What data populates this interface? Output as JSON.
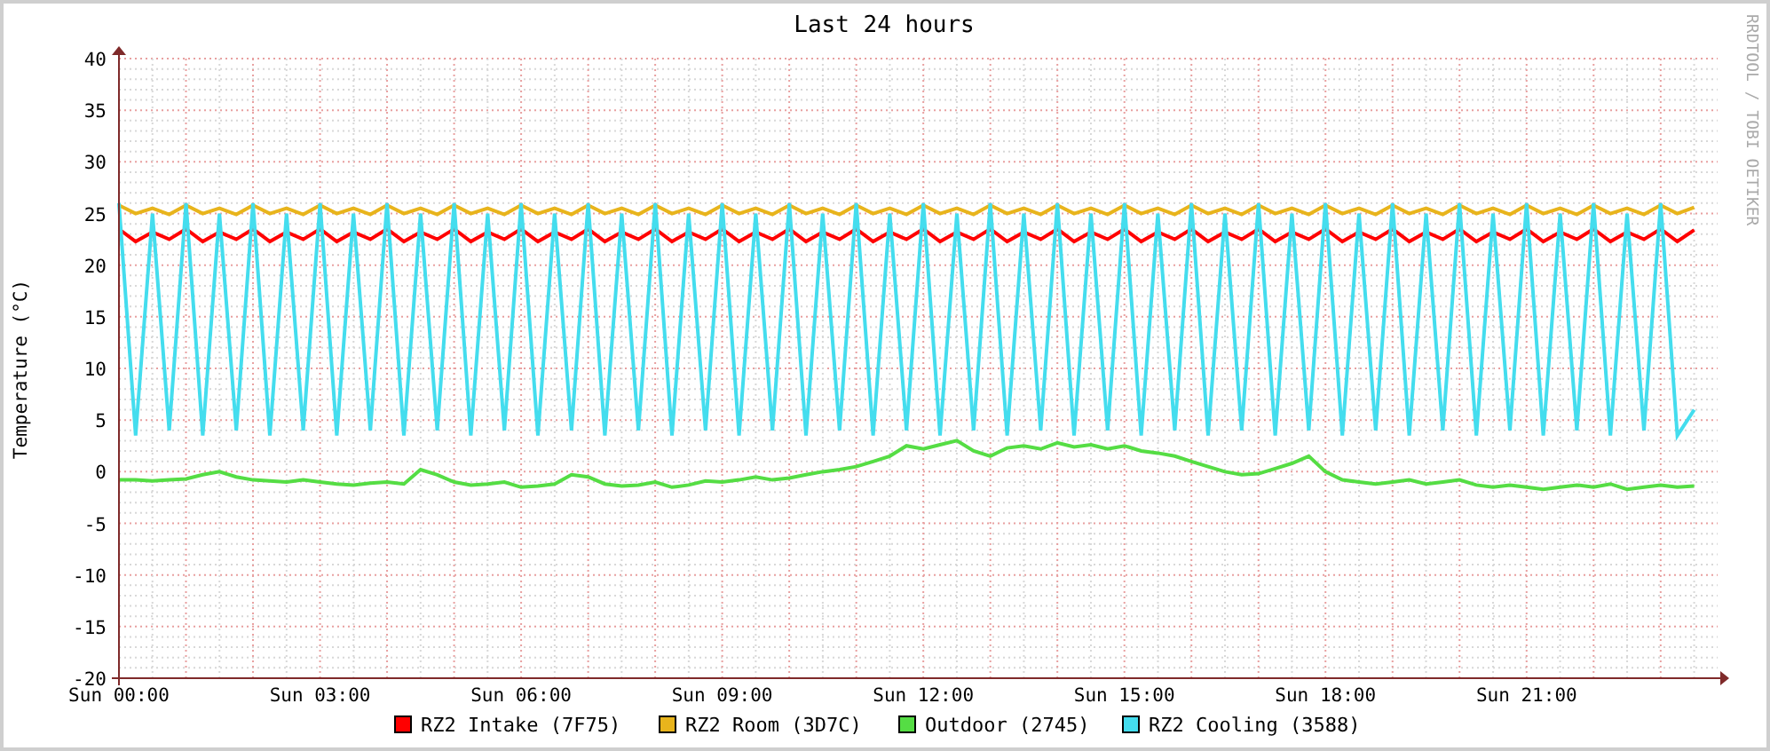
{
  "graph": {
    "side_text": "RRDTOOL / TOBI OETIKER",
    "chart_data": {
      "type": "line",
      "title": "Last 24 hours",
      "ylabel": "Temperature (°C)",
      "categories": [
        "Sun 00:00",
        null,
        null,
        null,
        null,
        null,
        null,
        null,
        null,
        null,
        null,
        null,
        "Sun 03:00",
        null,
        null,
        null,
        null,
        null,
        null,
        null,
        null,
        null,
        null,
        null,
        "Sun 06:00",
        null,
        null,
        null,
        null,
        null,
        null,
        null,
        null,
        null,
        null,
        null,
        "Sun 09:00",
        null,
        null,
        null,
        null,
        null,
        null,
        null,
        null,
        null,
        null,
        null,
        "Sun 12:00",
        null,
        null,
        null,
        null,
        null,
        null,
        null,
        null,
        null,
        null,
        null,
        "Sun 15:00",
        null,
        null,
        null,
        null,
        null,
        null,
        null,
        null,
        null,
        null,
        null,
        "Sun 18:00",
        null,
        null,
        null,
        null,
        null,
        null,
        null,
        null,
        null,
        null,
        null,
        "Sun 21:00",
        null,
        null,
        null,
        null,
        null,
        null,
        null,
        null,
        null,
        null
      ],
      "ylim": [
        -20,
        40
      ],
      "grid": true,
      "legend": "bottom",
      "yticks": [
        -20,
        -15,
        -10,
        -5,
        0,
        5,
        10,
        15,
        20,
        25,
        30,
        35,
        40
      ],
      "series": [
        {
          "name": "RZ2 Intake (7F75)",
          "color": "#ff0000",
          "values": [
            23.5,
            22.3,
            23.2,
            22.5,
            23.5,
            22.3,
            23.2,
            22.5,
            23.5,
            22.3,
            23.2,
            22.5,
            23.5,
            22.3,
            23.2,
            22.5,
            23.5,
            22.3,
            23.2,
            22.5,
            23.5,
            22.3,
            23.2,
            22.5,
            23.5,
            22.3,
            23.2,
            22.5,
            23.5,
            22.3,
            23.2,
            22.5,
            23.5,
            22.3,
            23.2,
            22.5,
            23.5,
            22.3,
            23.2,
            22.5,
            23.5,
            22.3,
            23.2,
            22.5,
            23.5,
            22.3,
            23.2,
            22.5,
            23.5,
            22.3,
            23.2,
            22.5,
            23.5,
            22.3,
            23.2,
            22.5,
            23.5,
            22.3,
            23.2,
            22.5,
            23.5,
            22.3,
            23.2,
            22.5,
            23.5,
            22.3,
            23.2,
            22.5,
            23.5,
            22.3,
            23.2,
            22.5,
            23.5,
            22.3,
            23.2,
            22.5,
            23.5,
            22.3,
            23.2,
            22.5,
            23.5,
            22.3,
            23.2,
            22.5,
            23.5,
            22.3,
            23.2,
            22.5,
            23.5,
            22.3,
            23.2,
            22.5,
            23.5,
            22.3,
            23.4
          ]
        },
        {
          "name": "RZ2 Room (3D7C)",
          "color": "#e8b41c",
          "values": [
            25.8,
            25,
            25.5,
            24.9,
            25.8,
            25,
            25.5,
            24.9,
            25.8,
            25,
            25.5,
            24.9,
            25.8,
            25,
            25.5,
            24.9,
            25.8,
            25,
            25.5,
            24.9,
            25.8,
            25,
            25.5,
            24.9,
            25.8,
            25,
            25.5,
            24.9,
            25.8,
            25,
            25.5,
            24.9,
            25.8,
            25,
            25.5,
            24.9,
            25.8,
            25,
            25.5,
            24.9,
            25.8,
            25,
            25.5,
            24.9,
            25.8,
            25,
            25.5,
            24.9,
            25.8,
            25,
            25.5,
            24.9,
            25.8,
            25,
            25.5,
            24.9,
            25.8,
            25,
            25.5,
            24.9,
            25.8,
            25,
            25.5,
            24.9,
            25.8,
            25,
            25.5,
            24.9,
            25.8,
            25,
            25.5,
            24.9,
            25.8,
            25,
            25.5,
            24.9,
            25.8,
            25,
            25.5,
            24.9,
            25.8,
            25,
            25.5,
            24.9,
            25.8,
            25,
            25.5,
            24.9,
            25.8,
            25,
            25.5,
            24.9,
            25.8,
            25,
            25.6
          ]
        },
        {
          "name": "Outdoor (2745)",
          "color": "#55dd44",
          "values": [
            -0.8,
            -0.8,
            -0.9,
            -0.8,
            -0.7,
            -0.3,
            0,
            -0.5,
            -0.8,
            -0.9,
            -1,
            -0.8,
            -1,
            -1.2,
            -1.3,
            -1.1,
            -1,
            -1.2,
            0.2,
            -0.3,
            -1,
            -1.3,
            -1.2,
            -1,
            -1.5,
            -1.4,
            -1.2,
            -0.3,
            -0.5,
            -1.2,
            -1.4,
            -1.3,
            -1,
            -1.5,
            -1.3,
            -0.9,
            -1,
            -0.8,
            -0.5,
            -0.8,
            -0.6,
            -0.3,
            0,
            0.2,
            0.5,
            1,
            1.5,
            2.5,
            2.2,
            2.6,
            3,
            2,
            1.5,
            2.3,
            2.5,
            2.2,
            2.8,
            2.4,
            2.6,
            2.2,
            2.5,
            2,
            1.8,
            1.5,
            1,
            0.5,
            0,
            -0.3,
            -0.2,
            0.3,
            0.8,
            1.5,
            0,
            -0.8,
            -1,
            -1.2,
            -1,
            -0.8,
            -1.2,
            -1,
            -0.8,
            -1.3,
            -1.5,
            -1.3,
            -1.5,
            -1.7,
            -1.5,
            -1.3,
            -1.5,
            -1.2,
            -1.7,
            -1.5,
            -1.3,
            -1.5,
            -1.4
          ]
        },
        {
          "name": "RZ2 Cooling (3588)",
          "color": "#44ddee",
          "values": [
            26,
            3.5,
            25,
            4,
            26,
            3.5,
            25,
            4,
            26,
            3.5,
            25,
            4,
            26,
            3.5,
            25,
            4,
            26,
            3.5,
            25,
            4,
            26,
            3.5,
            25,
            4,
            26,
            3.5,
            25,
            4,
            26,
            3.5,
            25,
            4,
            26,
            3.5,
            25,
            4,
            26,
            3.5,
            25,
            4,
            26,
            3.5,
            25,
            4,
            26,
            3.5,
            25,
            4,
            26,
            3.5,
            25,
            4,
            26,
            3.5,
            25,
            4,
            26,
            3.5,
            25,
            4,
            26,
            3.5,
            25,
            4,
            26,
            3.5,
            25,
            4,
            26,
            3.5,
            25,
            4,
            26,
            3.5,
            25,
            4,
            26,
            3.5,
            25,
            4,
            26,
            3.5,
            25,
            4,
            26,
            3.5,
            25,
            4,
            26,
            3.5,
            25,
            4,
            26,
            3.5,
            6
          ]
        }
      ]
    }
  }
}
